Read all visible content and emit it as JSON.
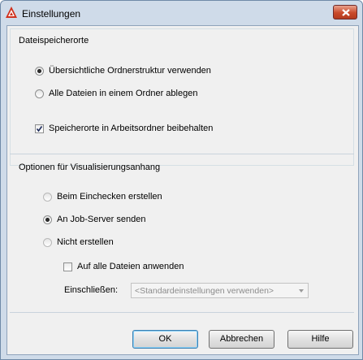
{
  "window": {
    "title": "Einstellungen"
  },
  "storage": {
    "title": "Dateispeicherorte",
    "option1": "Übersichtliche Ordnerstruktur verwenden",
    "option2": "Alle Dateien in einem Ordner ablegen",
    "keep_locations": "Speicherorte in Arbeitsordner beibehalten",
    "selected": "option1",
    "keep_locations_checked": true
  },
  "visualization": {
    "title": "Optionen für Visualisierungsanhang",
    "option1": "Beim Einchecken erstellen",
    "option2": "An Job-Server senden",
    "option3": "Nicht erstellen",
    "selected": "option2",
    "apply_all": "Auf alle Dateien anwenden",
    "apply_all_checked": false,
    "include_label": "Einschließen:",
    "include_value": "<Standardeinstellungen verwenden>"
  },
  "buttons": {
    "ok": "OK",
    "cancel": "Abbrechen",
    "help": "Hilfe"
  },
  "colors": {
    "accent": "#d0301c",
    "frame": "#cfdbe9",
    "panel": "#f0f0f0"
  }
}
